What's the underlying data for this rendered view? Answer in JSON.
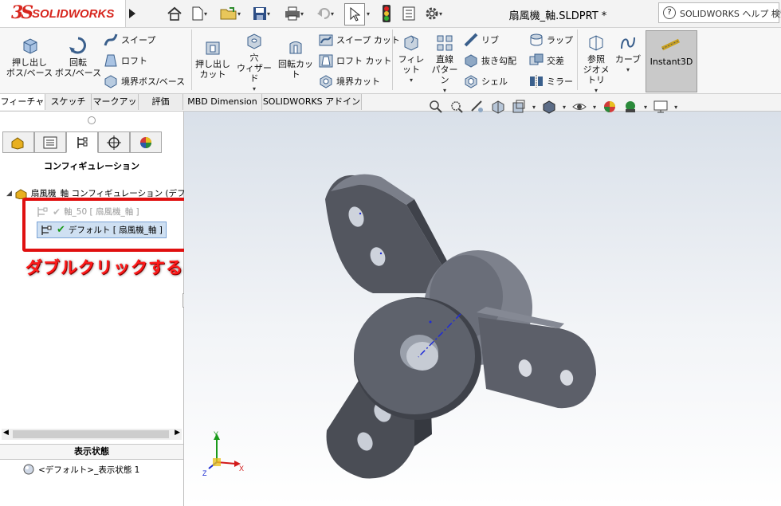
{
  "app": {
    "logo_mark": "3S",
    "logo_text": "SOLIDWORKS",
    "document_title": "扇風機_軸.SLDPRT *",
    "help_text": "SOLIDWORKS ヘルプ 検索"
  },
  "icons": [
    "home-icon",
    "new-doc-icon",
    "open-icon",
    "save-icon",
    "print-icon",
    "undo-icon",
    "select-icon",
    "traffic-light-icon",
    "file-properties-icon",
    "options-gear-icon"
  ],
  "ribbon": {
    "extrude_boss": "押し出し\nボス/ベース",
    "revolve_boss": "回転\nボス/ベース",
    "sweep": "スイープ",
    "loft": "ロフト",
    "boundary_boss": "境界ボス/ベース",
    "extrude_cut": "押し出し\nカット",
    "hole_wizard": "穴\nウィザード",
    "revolve_cut": "回転カット",
    "sweep_cut": "スイープ カット",
    "loft_cut": "ロフト カット",
    "boundary_cut": "境界カット",
    "fillet": "フィレット",
    "linear_pattern": "直線\nパターン",
    "rib": "リブ",
    "draft": "抜き勾配",
    "shell": "シェル",
    "wrap": "ラップ",
    "intersect": "交差",
    "mirror": "ミラー",
    "ref_geometry": "参照\nジオメトリ",
    "curves": "カーブ",
    "instant3d": "Instant3D"
  },
  "tabs": [
    "フィーチャー",
    "スケッチ",
    "マークアップ",
    "評価",
    "MBD Dimension",
    "SOLIDWORKS アドイン"
  ],
  "panel": {
    "title": "コンフィギュレーション",
    "root": "扇風機_軸 コンフィギュレーション (デフォルト)",
    "configs": [
      "軸_50 [ 扇風機_軸 ]",
      "デフォルト [ 扇風機_軸 ]"
    ],
    "display_state_title": "表示状態",
    "display_state": "<デフォルト>_表示状態 1"
  },
  "note": "ダブルクリックすると表示が変わる",
  "axes": {
    "x": "X",
    "y": "Y",
    "z": "Z"
  },
  "colors": {
    "brand_red": "#d7261e",
    "callout_red": "#e01010",
    "note_red": "#ff1a1a",
    "model_gray": "#5c5f69"
  }
}
